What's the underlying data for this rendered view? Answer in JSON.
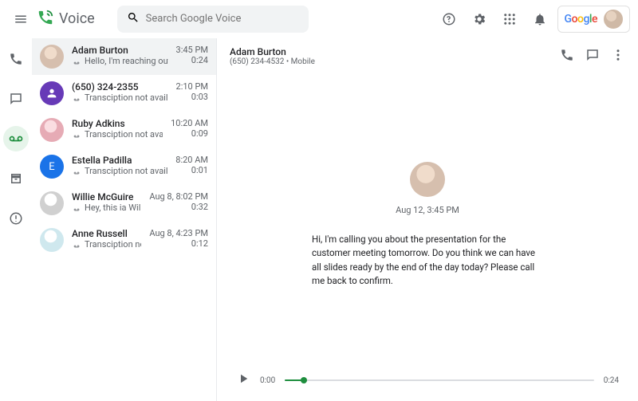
{
  "header": {
    "app_name": "Voice",
    "search_placeholder": "Search Google Voice",
    "google_letters": [
      "G",
      "o",
      "o",
      "g",
      "l",
      "e"
    ]
  },
  "voicemails": [
    {
      "name": "Adam Burton",
      "preview": "Hello, I'm reaching out to…",
      "time": "3:45 PM",
      "duration": "0:24",
      "avatar": "av-photo",
      "initial": "",
      "selected": true
    },
    {
      "name": "(650) 324-2355",
      "preview": "Transciption not available",
      "time": "2:10 PM",
      "duration": "0:03",
      "avatar": "av-purple",
      "initial": "",
      "selected": false
    },
    {
      "name": "Ruby Adkins",
      "preview": "Transciption not available",
      "time": "10:20 AM",
      "duration": "0:09",
      "avatar": "av-pink",
      "initial": "",
      "selected": false
    },
    {
      "name": "Estella Padilla",
      "preview": "Transciption not available",
      "time": "8:20 AM",
      "duration": "0:01",
      "avatar": "av-blue",
      "initial": "E",
      "selected": false
    },
    {
      "name": "Willie McGuire",
      "preview": "Hey, this ia Willie calling …",
      "time": "Aug 8, 8:02 PM",
      "duration": "0:32",
      "avatar": "av-grey",
      "initial": "",
      "selected": false
    },
    {
      "name": "Anne Russell",
      "preview": "Transciption not available",
      "time": "Aug 8, 4:23 PM",
      "duration": "0:12",
      "avatar": "av-teal",
      "initial": "",
      "selected": false
    }
  ],
  "detail": {
    "name": "Adam Burton",
    "subtitle": "(650) 234-4532 • Mobile",
    "timestamp": "Aug 12, 3:45 PM",
    "transcript": "Hi, I'm calling you about the presentation for the customer meeting tomorrow. Do you think we can have all slides ready by the end of the day today? Please call me back to confirm.",
    "player": {
      "current": "0:00",
      "total": "0:24"
    }
  }
}
